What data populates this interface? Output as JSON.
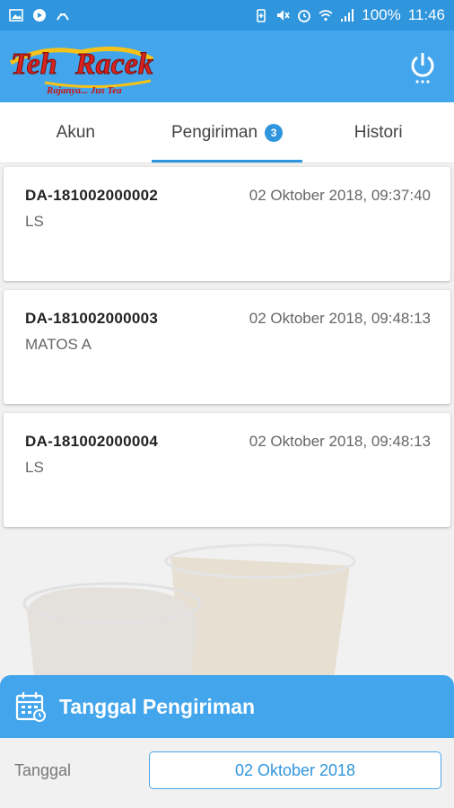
{
  "status_bar": {
    "battery": "100%",
    "time": "11:46",
    "icons": [
      "image-icon",
      "circle-icon",
      "wave-icon",
      "battery-saver-icon",
      "mute-icon",
      "alarm-icon",
      "wifi-icon",
      "signal-icon"
    ]
  },
  "app_bar": {
    "logo_text": "Teh Racek",
    "logo_tagline": "Rajanya... Jus Tea",
    "power_icon": "power-icon"
  },
  "tabs": [
    {
      "label": "Akun",
      "active": false
    },
    {
      "label": "Pengiriman",
      "active": true,
      "badge": "3"
    },
    {
      "label": "Histori",
      "active": false
    }
  ],
  "deliveries": [
    {
      "id": "DA-181002000002",
      "datetime": "02 Oktober 2018, 09:37:40",
      "location": "LS"
    },
    {
      "id": "DA-181002000003",
      "datetime": "02 Oktober 2018, 09:48:13",
      "location": "MATOS A"
    },
    {
      "id": "DA-181002000004",
      "datetime": "02 Oktober 2018, 09:48:13",
      "location": "LS"
    }
  ],
  "bottom_panel": {
    "title": "Tanggal Pengiriman",
    "date_label": "Tanggal",
    "date_value": "02 Oktober 2018"
  },
  "colors": {
    "primary": "#43a6ec",
    "primary_dark": "#2f95dc",
    "logo_red": "#d9231f",
    "logo_yellow": "#f5c21a"
  }
}
